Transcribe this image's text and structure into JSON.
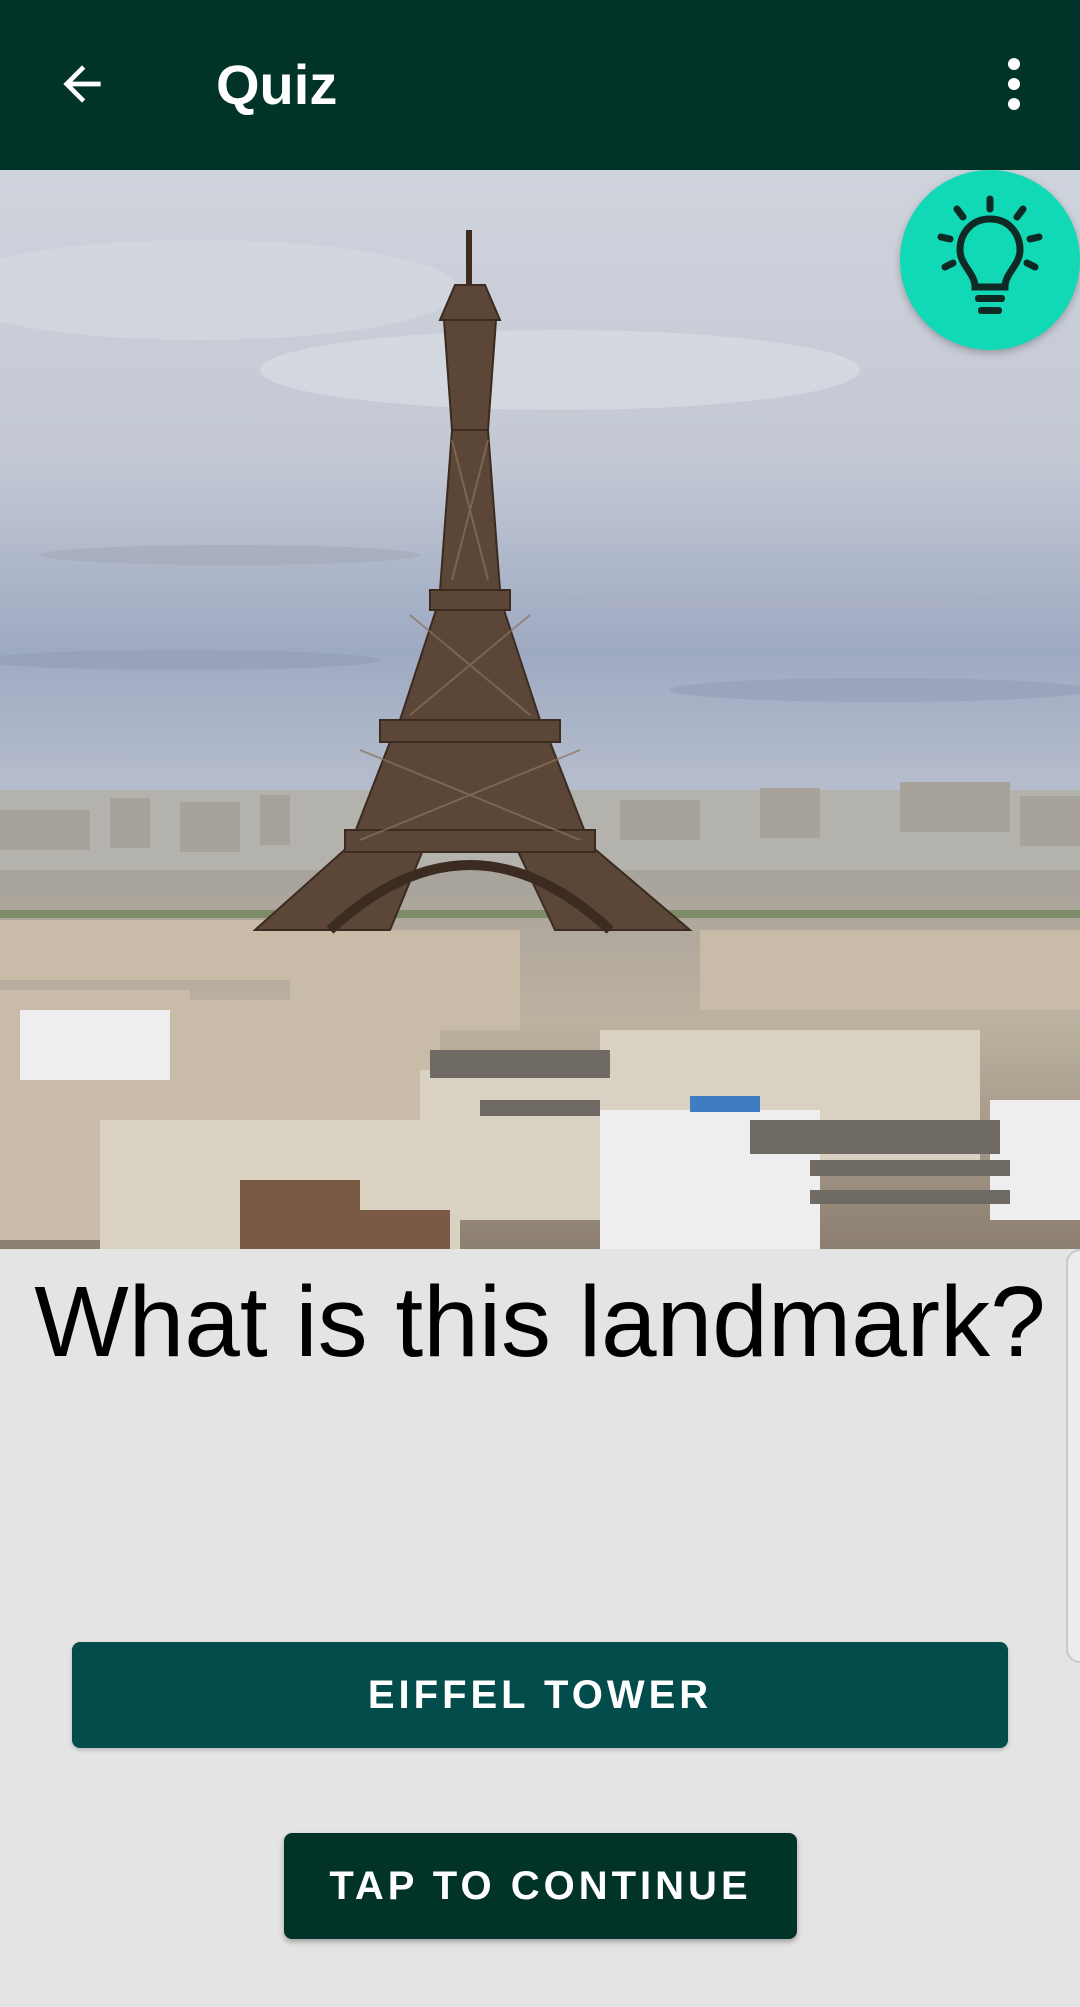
{
  "app_bar": {
    "title": "Quiz",
    "back_icon": "arrow-back-icon",
    "menu_icon": "more-vert-icon",
    "background": "#013328"
  },
  "hero": {
    "image_subject": "eiffel-tower-photo",
    "hint_icon": "lightbulb-icon",
    "hint_color": "#11d8b5"
  },
  "question": {
    "text": "What is this landmark?"
  },
  "buttons": {
    "answer_label": "EIFFEL TOWER",
    "answer_color": "#024d4c",
    "continue_label": "TAP TO CONTINUE",
    "continue_color": "#013328"
  }
}
